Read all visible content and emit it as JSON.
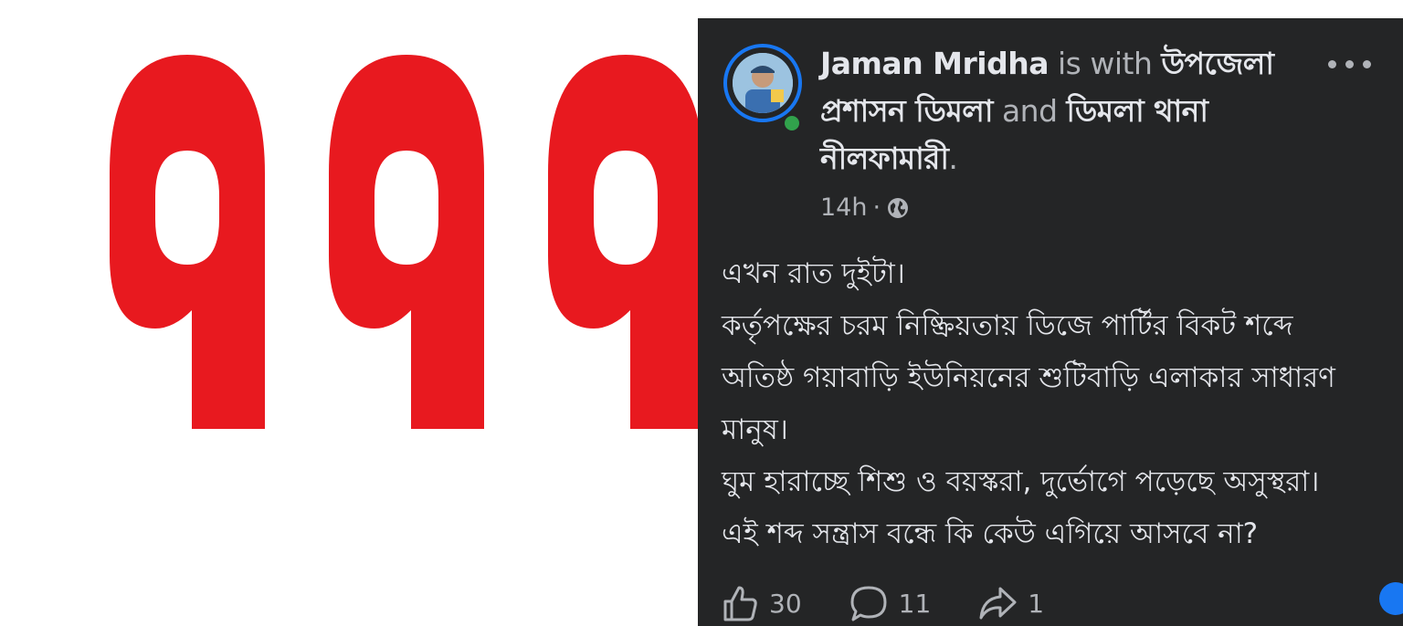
{
  "logo": {
    "text": "999",
    "color": "#e8191f"
  },
  "post": {
    "author": "Jaman Mridha",
    "with_text": "is with",
    "tag_1": "উপজেলা প্রশাসন ডিমলা",
    "and_text": "and",
    "tag_2": "ডিমলা থানা নীলফামারী",
    "end_punct": ".",
    "time": "14h",
    "separator": "·",
    "privacy_icon": "globe-icon",
    "more_icon": "more-options-icon",
    "body_lines": [
      "এখন রাত দুইটা।",
      "কর্তৃপক্ষের চরম নিষ্ক্রিয়তায় ডিজে পার্টির বিকট শব্দে",
      "অতিষ্ঠ গয়াবাড়ি ইউনিয়নের শুটিবাড়ি এলাকার সাধারণ",
      "মানুষ।",
      "ঘুম হারাচ্ছে শিশু ও বয়স্করা, দুর্ভোগে পড়েছে অসুস্থরা।",
      "এই শব্দ সন্ত্রাস বন্ধে কি কেউ এগিয়ে আসবে না?"
    ],
    "likes": "30",
    "comments": "11",
    "shares": "1",
    "colors": {
      "background": "#242526",
      "accent": "#1877f2",
      "online": "#31a24c"
    }
  }
}
